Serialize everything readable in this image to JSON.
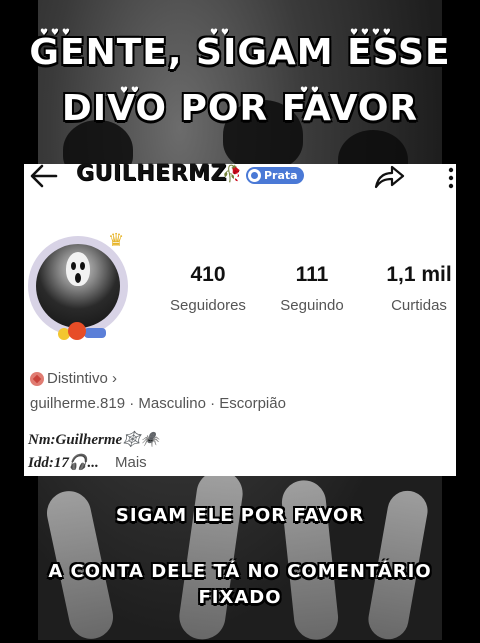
{
  "overlay": {
    "line1": "GENTE, SIGAM ESSE",
    "line2": "DIVO POR FAVOR",
    "line3": "SIGAM ELE POR FAVOR",
    "line4": "A CONTA DELE TÁ NO COMENTÁRIO",
    "line5": "FIXADO"
  },
  "profile": {
    "username": "GUILHERMZ",
    "badge_label": "Prata",
    "stats": [
      {
        "value": "410",
        "label": "Seguidores"
      },
      {
        "value": "111",
        "label": "Seguindo"
      },
      {
        "value": "1,1 mil",
        "label": "Curtidas"
      }
    ],
    "distintivo": "Distintivo ›",
    "info_line": "guilherme.819 · Masculino · Escorpião",
    "bio_line1": "Nm:Guilherme🕸️🕷️",
    "bio_line2": "Idd:17🎧...",
    "more_label": "Mais"
  },
  "icons": {
    "back": "arrow-left-icon",
    "share": "share-icon",
    "more": "more-vertical-icon",
    "rose": "rose-icon",
    "crown": "crown-icon"
  },
  "colors": {
    "badge": "#4a79d6",
    "rose": "#c41c30",
    "crown": "#e7b52a"
  }
}
